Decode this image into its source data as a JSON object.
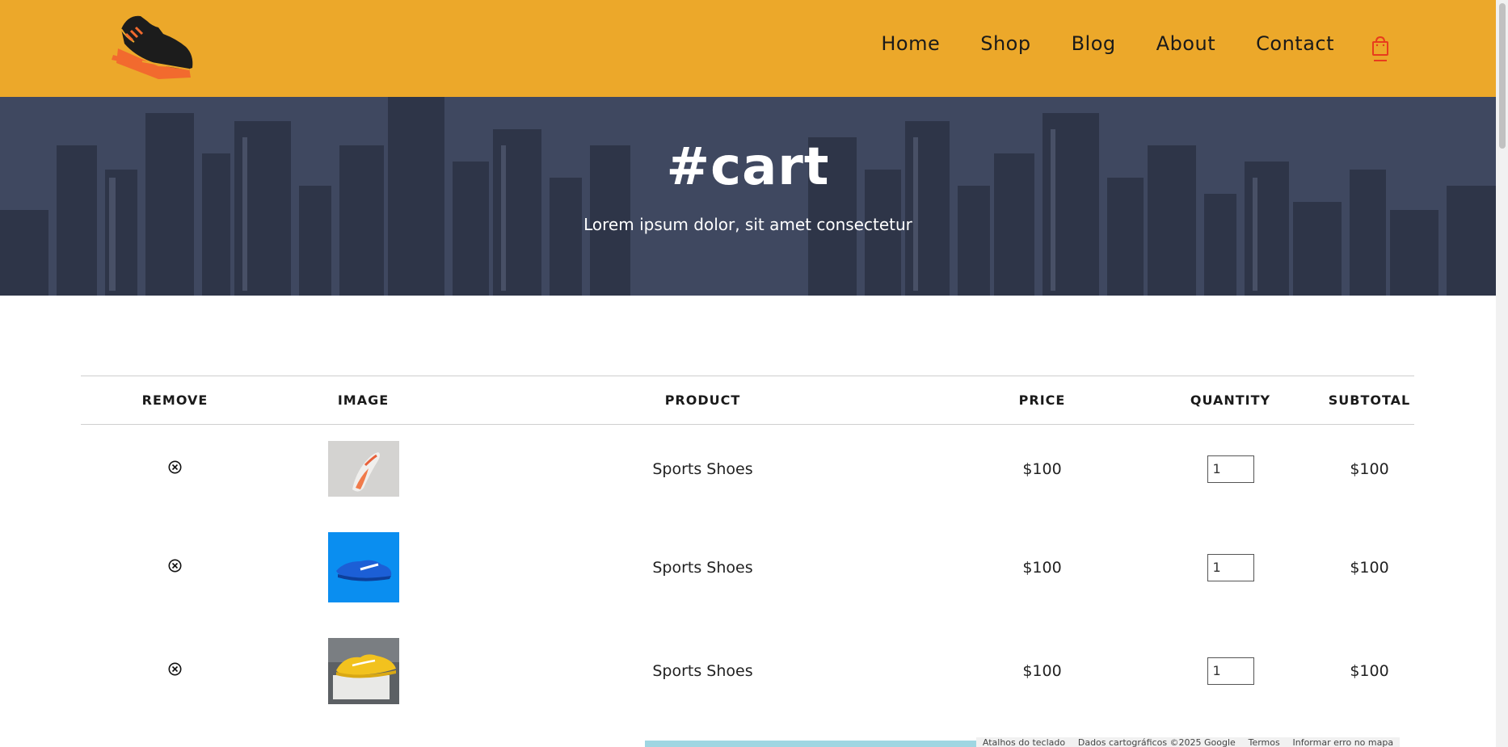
{
  "nav": {
    "links": [
      "Home",
      "Shop",
      "Blog",
      "About",
      "Contact"
    ],
    "cart_icon": "shopping-bag-icon",
    "active_color": "#e83c1c"
  },
  "hero": {
    "title": "#cart",
    "subtitle": "Lorem ipsum dolor, sit amet consectetur"
  },
  "table": {
    "headers": [
      "REMOVE",
      "IMAGE",
      "PRODUCT",
      "PRICE",
      "QUANTITY",
      "SUBTOTAL"
    ],
    "rows": [
      {
        "product": "Sports Shoes",
        "price": "$100",
        "quantity": "1",
        "subtotal": "$100",
        "image": "white-orange-sneaker"
      },
      {
        "product": "Sports Shoes",
        "price": "$100",
        "quantity": "1",
        "subtotal": "$100",
        "image": "blue-sneaker"
      },
      {
        "product": "Sports Shoes",
        "price": "$100",
        "quantity": "1",
        "subtotal": "$100",
        "image": "yellow-sneaker"
      }
    ]
  },
  "map": {
    "credits": [
      "Atalhos do teclado",
      "Dados cartográficos ©2025 Google",
      "Termos",
      "Informar erro no mapa"
    ]
  },
  "colors": {
    "header_bg": "#eca82a",
    "hero_bg": "#3a4257",
    "accent": "#e83c1c"
  }
}
